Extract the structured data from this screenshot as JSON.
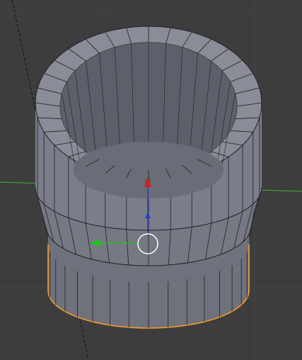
{
  "viewport": {
    "background": "#3d3d3d",
    "grid_color": "#454545",
    "floor_axis_color": "#3bb13b",
    "mesh_face_color": "#7b7d8a",
    "mesh_inner_color": "#5d5f6b",
    "mesh_edge_color": "#1f1f24",
    "selected_edge_color": "#f39c2b",
    "origin_dot_color": "#f3a35a"
  },
  "object": {
    "name_semantic": "tube-mesh",
    "selected": true,
    "segments": 32
  },
  "gizmo": {
    "x_axis_color": "#cf1f1f",
    "y_axis_color": "#22c022",
    "z_axis_color": "#1f3bd6",
    "center_ring_color": "#ffffff",
    "icons": [
      "move-arrow-up-icon",
      "move-arrow-left-icon",
      "move-arrow-z-icon",
      "gizmo-center-ring-icon"
    ]
  }
}
